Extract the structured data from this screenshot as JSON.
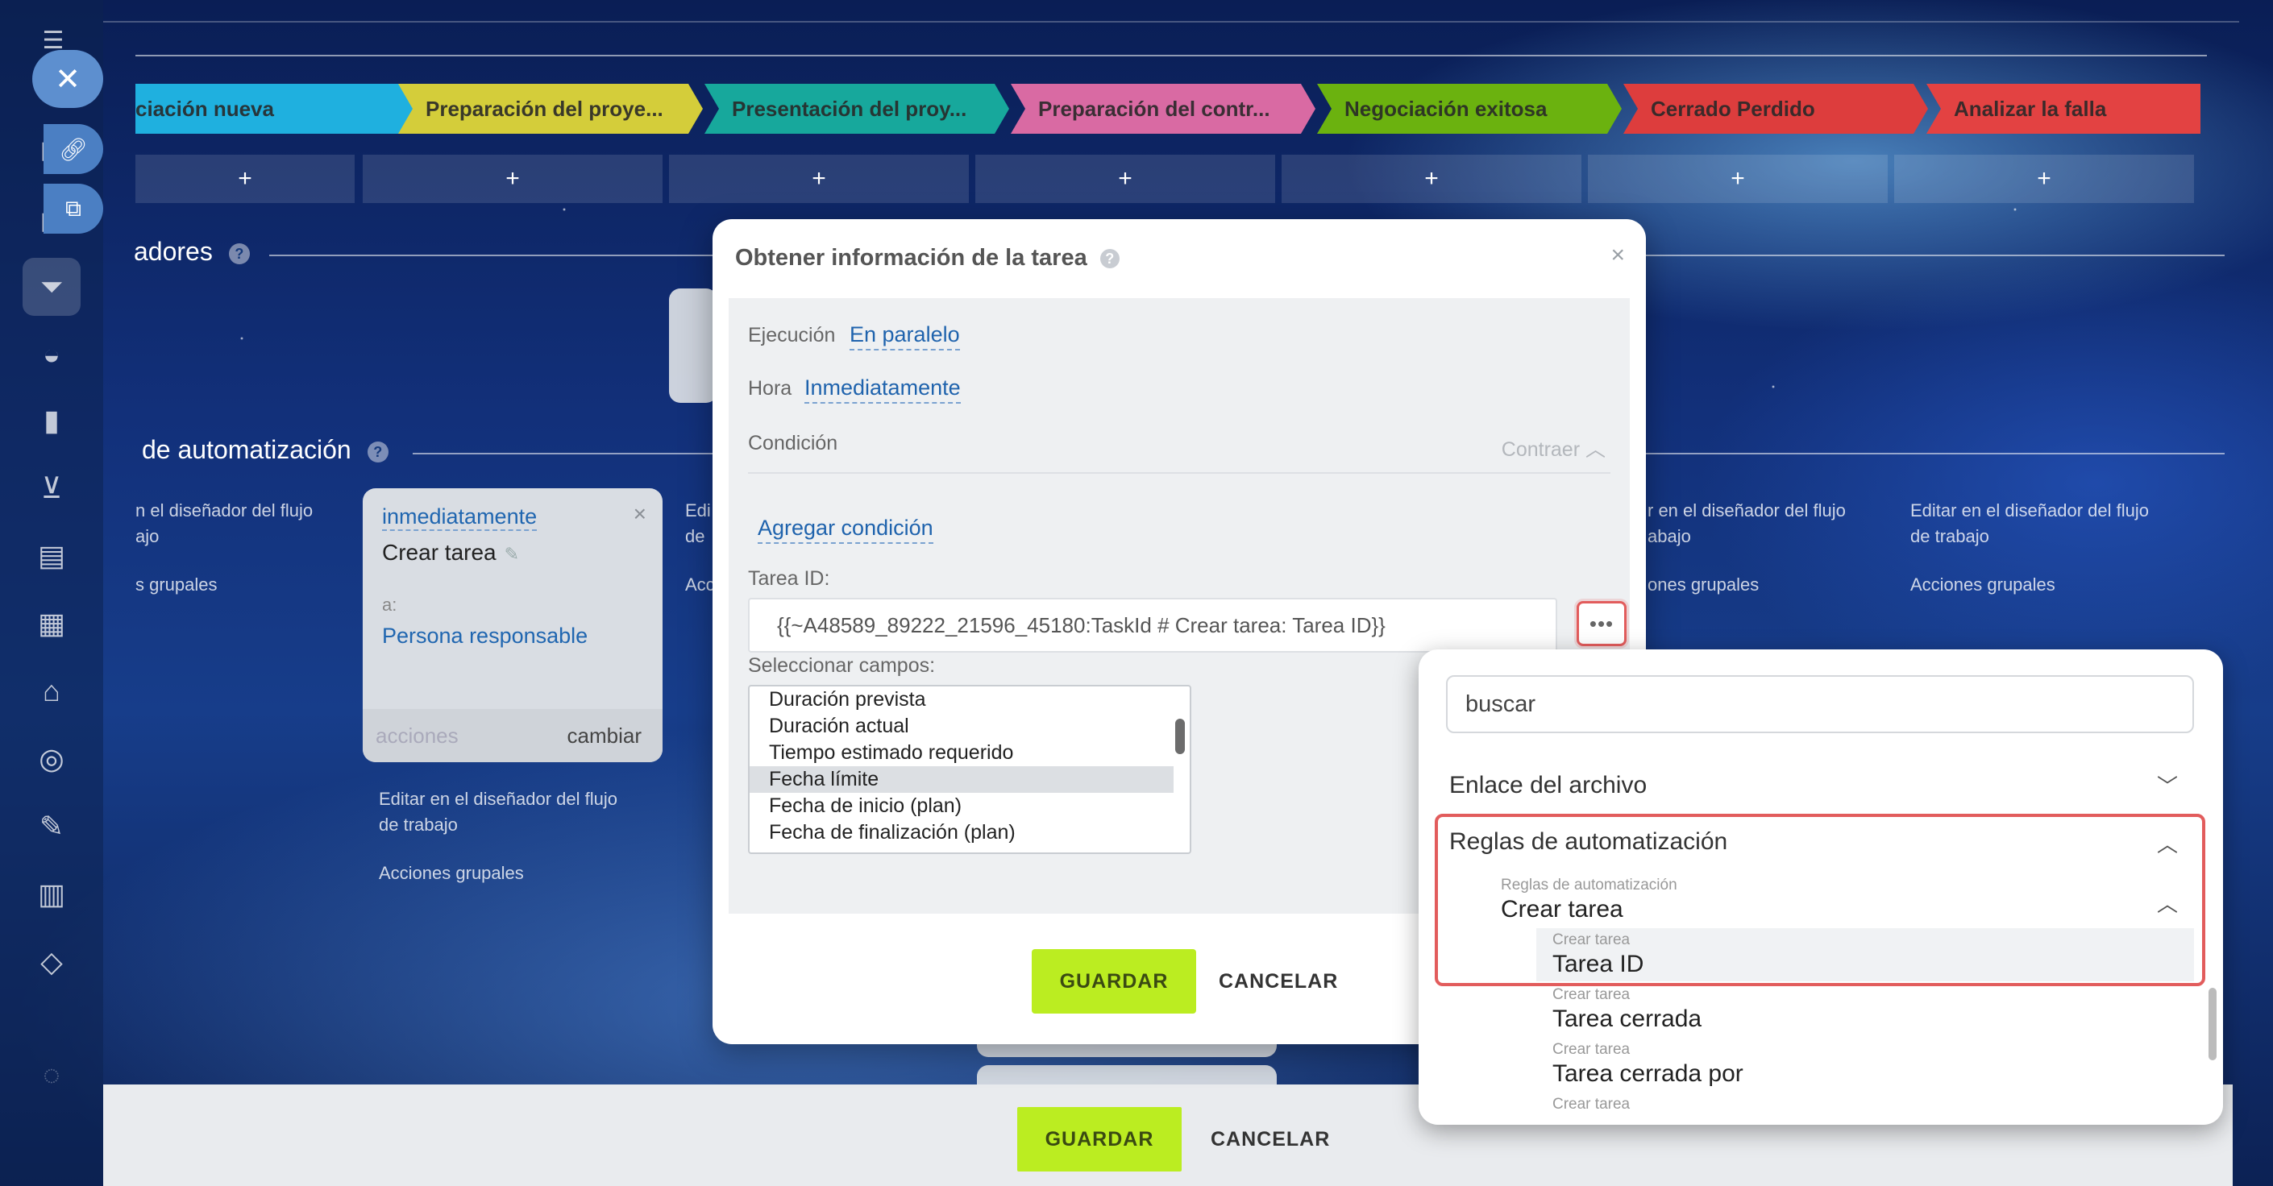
{
  "stages": [
    {
      "label": "ciación nueva",
      "color": "#1fb0df"
    },
    {
      "label": "Preparación del proye...",
      "color": "#d4cd3a"
    },
    {
      "label": "Presentación del proy...",
      "color": "#17a89c"
    },
    {
      "label": "Preparación del contr...",
      "color": "#d96aa3"
    },
    {
      "label": "Negociación exitosa",
      "color": "#6bb20f"
    },
    {
      "label": "Cerrado Perdido",
      "color": "#dd3d3d"
    },
    {
      "label": "Analizar la falla",
      "color": "#e34242"
    }
  ],
  "plus_label": "+",
  "sections": {
    "disparadores": "adores",
    "reglas": "de automatización",
    "help": "?"
  },
  "columns": {
    "col1_edit_a": "n el diseñador del flujo",
    "col1_edit_b": "ajo",
    "col1_group": "s grupales",
    "col2_edit_a": "Editar en el diseñador del flujo",
    "col2_edit_b": "de trabajo",
    "col2_group": "Acciones grupales",
    "col3_partial": "Edi",
    "col3_partial_b": "de",
    "col3_partial_c": "Acc",
    "col6_edit_a": "r en el diseñador del flujo",
    "col6_edit_b": "abajo",
    "col6_group": "ones grupales",
    "col7_edit_a": "Editar en el diseñador del flujo",
    "col7_edit_b": "de trabajo",
    "col7_group": "Acciones grupales"
  },
  "rule_card": {
    "timing": "inmediatamente",
    "title": "Crear tarea",
    "to_label": "a:",
    "assignee": "Persona responsable",
    "actions": "acciones",
    "change": "cambiar",
    "close": "×"
  },
  "bottom_bar": {
    "save": "GUARDAR",
    "cancel": "CANCELAR"
  },
  "modal": {
    "title": "Obtener información de la tarea",
    "help": "?",
    "close": "×",
    "execution_label": "Ejecución",
    "execution_value": "En paralelo",
    "time_label": "Hora",
    "time_value": "Inmediatamente",
    "condition_label": "Condición",
    "collapse_label": "Contraer",
    "add_condition": "Agregar condición",
    "task_id_label": "Tarea ID:",
    "task_id_value": "{{~A48589_89222_21596_45180:TaskId # Crear tarea: Tarea ID}}",
    "dots": "•••",
    "fields_label": "Seleccionar campos:",
    "fields": [
      "Duración prevista",
      "Duración actual",
      "Tiempo estimado requerido",
      "Fecha límite",
      "Fecha de inicio (plan)",
      "Fecha de finalización (plan)"
    ],
    "selected_field": "Fecha límite",
    "save": "GUARDAR",
    "cancel": "CANCELAR"
  },
  "popup": {
    "search_value": "buscar",
    "group_file": "Enlace del archivo",
    "group_rules": "Reglas de automatización",
    "sub_caption": "Reglas de automatización",
    "sub_title": "Crear tarea",
    "items": [
      {
        "caption": "Crear tarea",
        "label": "Tarea ID"
      },
      {
        "caption": "Crear tarea",
        "label": "Tarea cerrada"
      },
      {
        "caption": "Crear tarea",
        "label": "Tarea cerrada por"
      },
      {
        "caption": "Crear tarea",
        "label": ""
      }
    ]
  },
  "colors": {
    "accent_green": "#bbed21",
    "link_blue": "#1f63ad",
    "highlight_red": "#e25c5c"
  }
}
